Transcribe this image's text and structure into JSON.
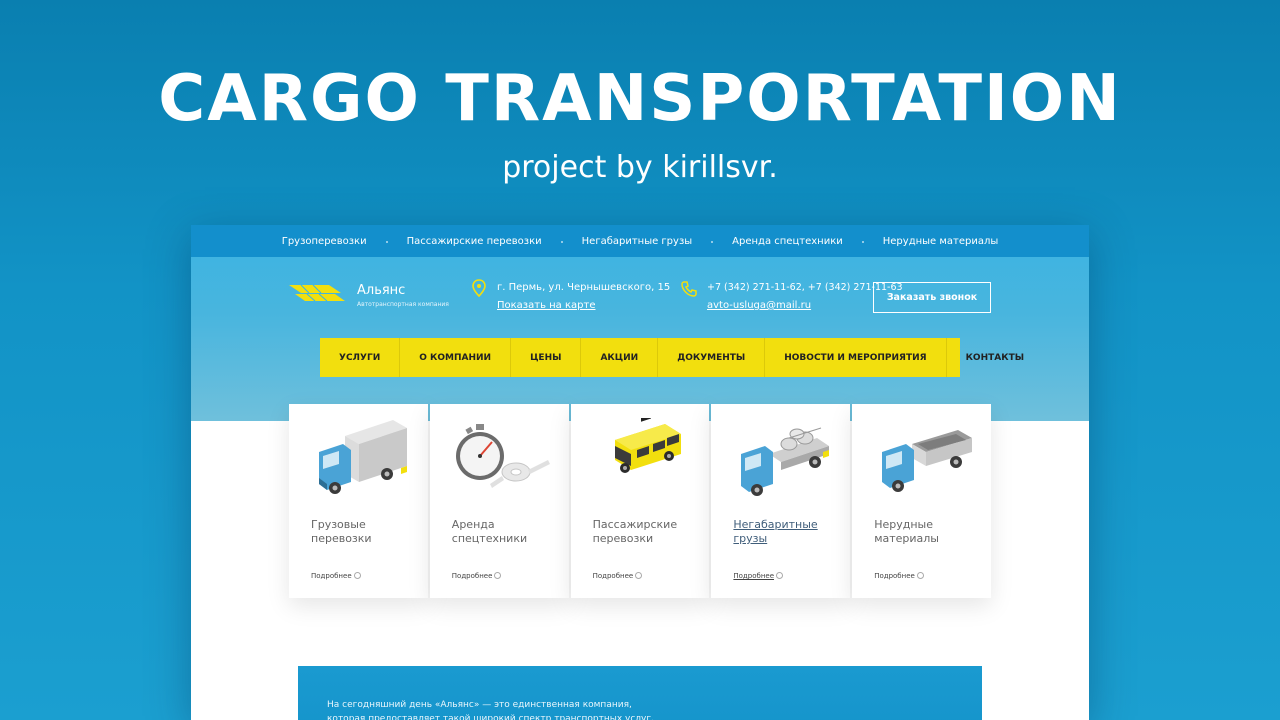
{
  "hero": {
    "title": "CARGO TRANSPORTATION",
    "subtitle": "project by kirillsvr."
  },
  "topbar": {
    "items": [
      "Грузоперевозки",
      "Пассажирские перевозки",
      "Негабаритные грузы",
      "Аренда спецтехники",
      "Нерудные материалы"
    ]
  },
  "header": {
    "logo_name": "Альянс",
    "logo_tagline": "Автотранспортная компания",
    "address": "г. Пермь, ул. Чернышевского, 15",
    "map_link": "Показать на карте",
    "phones": "+7 (342) 271-11-62, +7 (342) 271-11-63",
    "email": "avto-usluga@mail.ru",
    "callback_button": "Заказать звонок"
  },
  "menu": {
    "items": [
      "УСЛУГИ",
      "О КОМПАНИИ",
      "ЦЕНЫ",
      "АКЦИИ",
      "ДОКУМЕНТЫ",
      "НОВОСТИ И МЕРОПРИЯТИЯ",
      "КОНТАКТЫ"
    ]
  },
  "services": {
    "more_label": "Подробнее",
    "cards": [
      {
        "title": "Грузовые перевозки",
        "icon": "cargo-truck-icon"
      },
      {
        "title": "Аренда спецтехники",
        "icon": "stopwatch-key-icon"
      },
      {
        "title": "Пассажирские перевозки",
        "icon": "taxi-van-icon"
      },
      {
        "title": "Негабаритные грузы",
        "icon": "pipe-truck-icon"
      },
      {
        "title": "Нерудные материалы",
        "icon": "dump-truck-icon"
      }
    ]
  },
  "about": {
    "text": "На сегодняшний день «Альянс» — это единственная компания, которая предоставляет такой широкий спектр транспортных услуг. Нашими"
  },
  "colors": {
    "background": "#1293c6",
    "topbar": "#138fcc",
    "menu": "#f2df0e",
    "accent_truck_cab": "#4aa3d6"
  }
}
